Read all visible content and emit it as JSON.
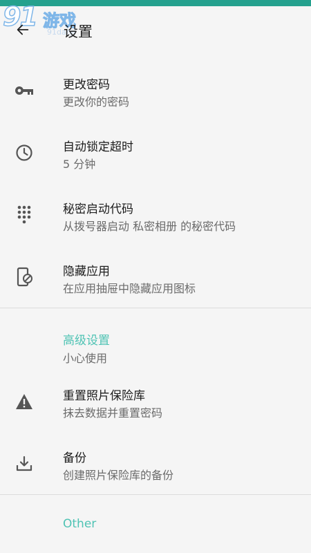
{
  "header": {
    "title": "设置"
  },
  "watermark": {
    "number": "91",
    "brand": "游戏",
    "sub": "91danji"
  },
  "items": [
    {
      "title": "更改密码",
      "subtitle": "更改你的密码",
      "icon": "key-icon"
    },
    {
      "title": "自动锁定超时",
      "subtitle": "5 分钟",
      "icon": "clock-icon"
    },
    {
      "title": "秘密启动代码",
      "subtitle": "从拨号器启动 私密相册 的秘密代码",
      "icon": "dialpad-icon"
    },
    {
      "title": "隐藏应用",
      "subtitle": "在应用抽屉中隐藏应用图标",
      "icon": "hidden-app-icon"
    }
  ],
  "advanced": {
    "heading": "高级设置",
    "subtitle": "小心使用",
    "items": [
      {
        "title": "重置照片保险库",
        "subtitle": "抹去数据并重置密码",
        "icon": "warning-icon"
      },
      {
        "title": "备份",
        "subtitle": "创建照片保险库的备份",
        "icon": "download-icon"
      }
    ]
  },
  "other": {
    "heading": "Other"
  },
  "colors": {
    "accent": "#4fc3b4",
    "status_bar": "#25a18e",
    "icon": "#555555"
  }
}
